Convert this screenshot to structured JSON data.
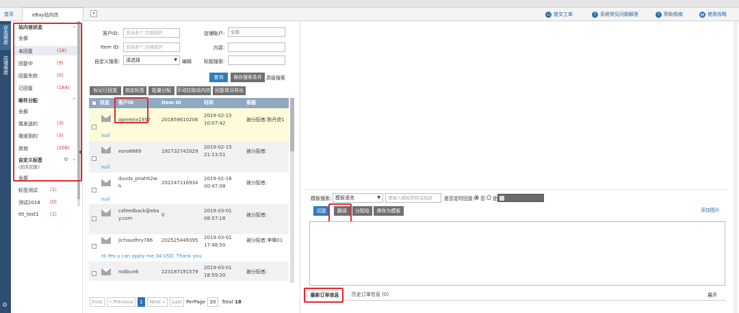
{
  "tabs": [
    {
      "label": "首页"
    },
    {
      "label": "eBay站内信(New)"
    }
  ],
  "header_links": [
    {
      "label": "提交工单",
      "icon": "ticket-icon"
    },
    {
      "label": "系统常见问题解答",
      "icon": "question-icon"
    },
    {
      "label": "帮助指南",
      "icon": "help-icon"
    },
    {
      "label": "使用攻略",
      "icon": "guide-icon"
    }
  ],
  "vertical_tabs": [
    {
      "label": "状态维度"
    },
    {
      "label": "店铺维度"
    }
  ],
  "left_panel": {
    "status_title": "站内信状态",
    "status_items": [
      {
        "label": "全部",
        "count": ""
      },
      {
        "label": "未回复",
        "count": "(18)"
      },
      {
        "label": "回复中",
        "count": "(9)"
      },
      {
        "label": "回复失败",
        "count": "(0)"
      },
      {
        "label": "已回复",
        "count": "(184)"
      }
    ],
    "mail_title": "邮件分配",
    "mail_items": [
      {
        "label": "全部",
        "count": ""
      },
      {
        "label": "我发送的",
        "count": "(3)"
      },
      {
        "label": "我收到的",
        "count": "(3)"
      },
      {
        "label": "其他",
        "count": "(208)"
      }
    ],
    "custom_title": "自定义标签",
    "custom_subtitle": "(回未回复)",
    "custom_items": [
      {
        "label": "全部",
        "count": ""
      },
      {
        "label": "标签测试",
        "count": "(1)"
      },
      {
        "label": "测试2018",
        "count": "(0)"
      },
      {
        "label": "ttt_test1",
        "count": "(1)"
      }
    ]
  },
  "search_form": {
    "customer_id_label": "客户ID:",
    "customer_id_placeholder": "支持多个,空格隔开",
    "store_label": "店铺账户:",
    "store_value": "全部",
    "item_id_label": "Item ID:",
    "item_id_placeholder": "支持多个,空格隔开",
    "content_label": "内容:",
    "custom_search_label": "自定义搜索:",
    "custom_search_value": "请选择",
    "edit_label": "编辑",
    "title_search_label": "标题搜索:",
    "search_button": "查询",
    "save_search_button": "保存搜索条件",
    "advanced_search": "高级搜索"
  },
  "action_buttons": [
    "标记已回复",
    "指定标签",
    "批量分配",
    "手动拉取站内信",
    "回复情况导出"
  ],
  "table": {
    "headers": [
      "状态",
      "客户ID",
      "Item ID",
      "时间",
      "客服"
    ],
    "rows": [
      {
        "customer": "opereira1957",
        "item": "201859610206",
        "time": "2019-02-15 10:07:42",
        "agent": "被分配者:陈丹虎1",
        "sub": "null",
        "highlight": true
      },
      {
        "customer": "eoro6889",
        "item": "192732742029",
        "time": "2019-02-15 21:13:51",
        "agent": "被分配者:",
        "sub": "null",
        "highlight": false
      },
      {
        "customer": "duvds_pnahh2wh",
        "item": "202247116934",
        "time": "2019-02-16 00:47:08",
        "agent": "被分配者:",
        "sub": "null",
        "highlight": false
      },
      {
        "customer": "csfeedback@ebay.com",
        "item": "0",
        "time": "2019-03-01 08:57:18",
        "agent": "被分配者:",
        "sub": "",
        "highlight": false
      },
      {
        "customer": "jichaudhry786",
        "item": "202525449395",
        "time": "2019-03-01 17:48:50",
        "agent": "被分配者:李琳01",
        "sub": "Hi.Yes u can apply me 34 USD. Thank you",
        "highlight": false
      },
      {
        "customer": "rodbun6",
        "item": "223187191579",
        "time": "2019-03-01 18:59:20",
        "agent": "被分配者:",
        "sub": "",
        "highlight": false
      }
    ]
  },
  "pagination": {
    "first": "First",
    "prev": "« Previous",
    "current": "1",
    "next": "Next »",
    "last": "Last",
    "per_page_label": "PerPage",
    "per_page_value": "20",
    "total_label": "Total",
    "total_value": "18"
  },
  "reply": {
    "template_search_label": "模板搜索:",
    "template_lang_value": "模板语言",
    "template_input_placeholder": "请输入模板简称或描述",
    "timed_reply_label": "是否定时回复:",
    "radio_no": "否",
    "radio_yes": "是",
    "reply_button": "回复",
    "translate_button": "翻译",
    "assign_button": "分配给",
    "save_template_button": "保存为模板",
    "add_image": "添加图片"
  },
  "bottom_tabs": {
    "latest_order": "最新订单信息",
    "history_order": "历史订单信息",
    "history_count": "(0)",
    "expand": "展开"
  }
}
